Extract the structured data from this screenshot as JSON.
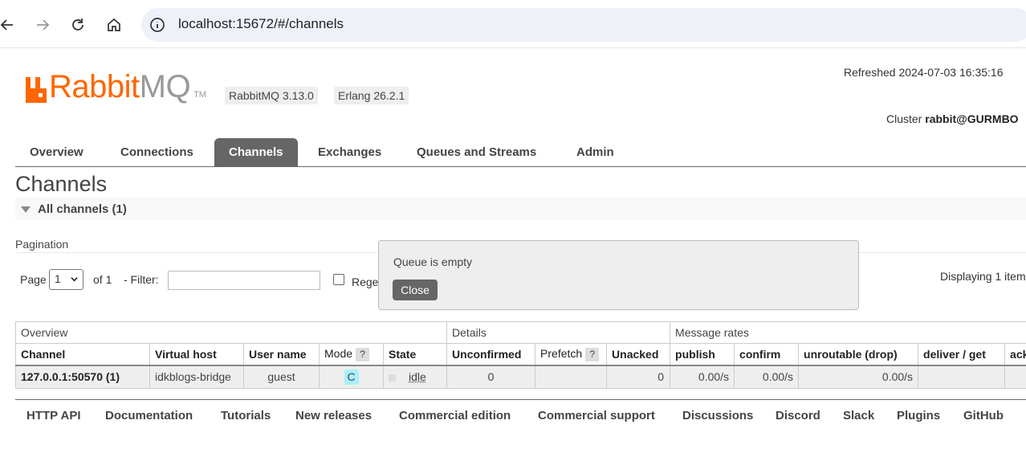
{
  "browser": {
    "url": "localhost:15672/#/channels"
  },
  "header": {
    "logo_rabbit": "Rabbit",
    "logo_mq": "MQ",
    "logo_tm": "TM",
    "version": "RabbitMQ 3.13.0",
    "erlang": "Erlang 26.2.1",
    "refreshed": "Refreshed 2024-07-03 16:35:16",
    "cluster_label": "Cluster",
    "cluster_name": "rabbit@GURMBO"
  },
  "tabs": [
    {
      "label": "Overview"
    },
    {
      "label": "Connections"
    },
    {
      "label": "Channels"
    },
    {
      "label": "Exchanges"
    },
    {
      "label": "Queues and Streams"
    },
    {
      "label": "Admin"
    }
  ],
  "page_title": "Channels",
  "section_label": "All channels (1)",
  "pagination": {
    "label": "Pagination",
    "page_label": "Page",
    "page_value": "1",
    "of_label": "of 1",
    "filter_label": "- Filter:",
    "regex_label": "Regex",
    "displaying": "Displaying 1 item"
  },
  "popup": {
    "message": "Queue is empty",
    "close_label": "Close"
  },
  "table": {
    "groups": [
      "Overview",
      "Details",
      "Message rates"
    ],
    "headers": {
      "channel": "Channel",
      "vhost": "Virtual host",
      "user": "User name",
      "mode": "Mode",
      "state": "State",
      "unconfirmed": "Unconfirmed",
      "prefetch": "Prefetch",
      "unacked": "Unacked",
      "publish": "publish",
      "confirm": "confirm",
      "unroutable": "unroutable (drop)",
      "deliver": "deliver / get",
      "ack": "ack"
    },
    "help_glyph": "?",
    "row": {
      "channel": "127.0.0.1:50570 (1)",
      "vhost": "idkblogs-bridge",
      "user": "guest",
      "mode": "C",
      "state": "idle",
      "unconfirmed": "0",
      "prefetch": "",
      "unacked": "0",
      "publish": "0.00/s",
      "confirm": "0.00/s",
      "unroutable": "0.00/s",
      "deliver": "",
      "ack": ""
    }
  },
  "footer": [
    {
      "label": "HTTP API"
    },
    {
      "label": "Documentation"
    },
    {
      "label": "Tutorials"
    },
    {
      "label": "New releases"
    },
    {
      "label": "Commercial edition"
    },
    {
      "label": "Commercial support"
    },
    {
      "label": "Discussions"
    },
    {
      "label": "Discord"
    },
    {
      "label": "Slack"
    },
    {
      "label": "Plugins"
    },
    {
      "label": "GitHub"
    }
  ]
}
